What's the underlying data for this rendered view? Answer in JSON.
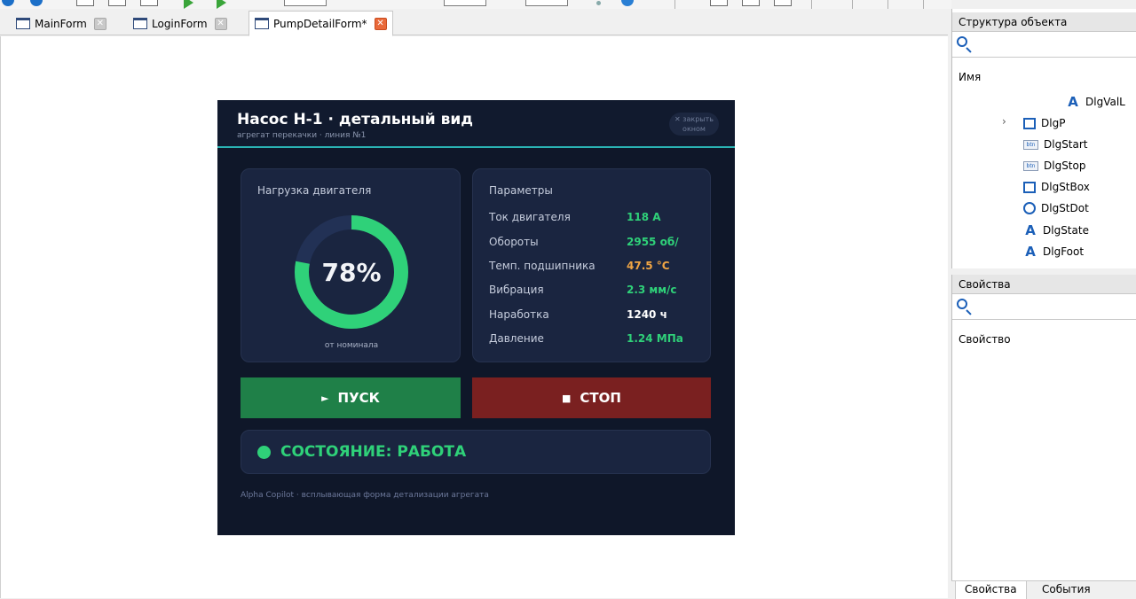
{
  "tabs": [
    {
      "label": "MainForm",
      "active": false
    },
    {
      "label": "LoginForm",
      "active": false
    },
    {
      "label": "PumpDetailForm*",
      "active": true
    }
  ],
  "dialog": {
    "title": "Насос Н-1 · детальный вид",
    "subtitle": "агрегат перекачки · линия №1",
    "close_label": "✕ закрыть окном",
    "load_card": {
      "title": "Нагрузка двигателя",
      "value_text": "78%",
      "value": 78,
      "caption": "от номинала",
      "ring_color": "#2fd179",
      "track_color": "#223155"
    },
    "params_card": {
      "title": "Параметры",
      "rows": [
        {
          "name": "Ток двигателя",
          "value": "118 А",
          "color": "#2fd179"
        },
        {
          "name": "Обороты",
          "value": "2955 об/",
          "color": "#2fd179"
        },
        {
          "name": "Темп. подшипника",
          "value": "47.5 °C",
          "color": "#f0a544"
        },
        {
          "name": "Вибрация",
          "value": "2.3 мм/с",
          "color": "#2fd179"
        },
        {
          "name": "Наработка",
          "value": "1240 ч",
          "color": "#ffffff"
        },
        {
          "name": "Давление",
          "value": "1.24 МПа",
          "color": "#2fd179"
        }
      ]
    },
    "start_button": {
      "glyph": "►",
      "label": "ПУСК"
    },
    "stop_button": {
      "glyph": "■",
      "label": "СТОП"
    },
    "state_text": "СОСТОЯНИЕ: РАБОТА",
    "footer": "Alpha Copilot · всплывающая форма детализации агрегата"
  },
  "structure_panel": {
    "title": "Структура объекта",
    "column_header": "Имя",
    "items": [
      {
        "icon": "text-icon",
        "label": "DlgValL"
      },
      {
        "icon": "rect-icon",
        "label": "DlgP"
      },
      {
        "icon": "button-icon",
        "label": "DlgStart"
      },
      {
        "icon": "button-icon",
        "label": "DlgStop"
      },
      {
        "icon": "rect-icon",
        "label": "DlgStBox"
      },
      {
        "icon": "circle-icon",
        "label": "DlgStDot"
      },
      {
        "icon": "text-icon",
        "label": "DlgState"
      },
      {
        "icon": "text-icon",
        "label": "DlgFoot"
      }
    ]
  },
  "properties_panel": {
    "title": "Свойства",
    "column_header": "Свойство"
  },
  "bottom_tabs": [
    {
      "label": "Свойства",
      "active": true
    },
    {
      "label": "События",
      "active": false
    }
  ],
  "icon_glyphs": {
    "text": "A",
    "button": "btn",
    "close": "✕",
    "chevron": "›"
  }
}
